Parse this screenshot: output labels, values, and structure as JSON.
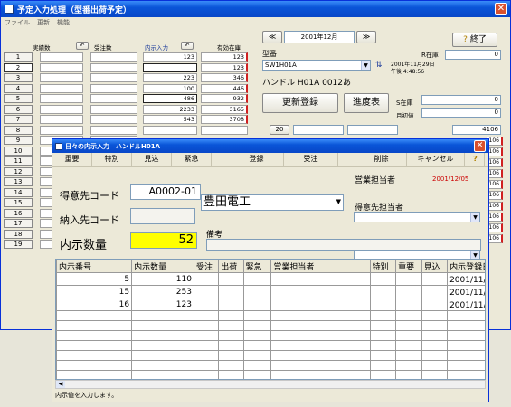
{
  "main": {
    "title": "予定入力処理（型番出荷予定）",
    "menu": [
      "ファイル",
      "更新",
      "機能"
    ],
    "headers": {
      "jisseki": "実績数",
      "juchu": "受注数",
      "naiji": "内示入力",
      "yuko": "有効在庫"
    },
    "rows": [
      {
        "n": "1",
        "naiji": "123",
        "yuko": "123"
      },
      {
        "n": "2",
        "naiji": "",
        "yuko": "123"
      },
      {
        "n": "3",
        "naiji": "223",
        "yuko": "346"
      },
      {
        "n": "4",
        "naiji": "100",
        "yuko": "446"
      },
      {
        "n": "5",
        "naiji": "486",
        "yuko": "932"
      },
      {
        "n": "6",
        "naiji": "2233",
        "yuko": "3165"
      },
      {
        "n": "7",
        "naiji": "543",
        "yuko": "3708"
      },
      {
        "n": "8",
        "naiji": "",
        "yuko": ""
      },
      {
        "n": "9",
        "naiji": "",
        "yuko": ""
      },
      {
        "n": "10",
        "naiji": "",
        "yuko": ""
      },
      {
        "n": "11",
        "naiji": "",
        "yuko": ""
      },
      {
        "n": "12",
        "naiji": "",
        "yuko": ""
      },
      {
        "n": "13",
        "naiji": "",
        "yuko": ""
      },
      {
        "n": "14",
        "naiji": "",
        "yuko": ""
      },
      {
        "n": "15",
        "naiji": "",
        "yuko": ""
      },
      {
        "n": "16",
        "naiji": "",
        "yuko": ""
      },
      {
        "n": "17",
        "naiji": "",
        "yuko": ""
      },
      {
        "n": "18",
        "naiji": "",
        "yuko": ""
      },
      {
        "n": "19",
        "naiji": "",
        "yuko": ""
      }
    ],
    "prev": "≪",
    "month": "2001年12月",
    "next": "≫",
    "end_label": "終了",
    "kataban_label": "型番",
    "r_zaiko_label": "R在庫",
    "r_zaiko_value": "0",
    "kataban_value": "SW1H01A",
    "date_line1": "2001年11月29日",
    "date_line2": "午後 4:48:56",
    "product_name": "ハンドル H01A 0012あ",
    "koshin_label": "更新登録",
    "shinchoku_label": "進度表",
    "s_zaiko_label": "S在庫",
    "s_zaiko_value": "0",
    "getsusho_label": "月初値",
    "getsusho_value": "0",
    "total_value": "4106",
    "row20": "20",
    "right_col_values": [
      "106",
      "106",
      "106",
      "106",
      "106",
      "106",
      "106",
      "106",
      "106",
      "106"
    ]
  },
  "sub": {
    "title": "日々の内示入力　ハンドルH01A",
    "toolbar": [
      "重要",
      "特別",
      "見込",
      "緊急",
      "登録",
      "受注",
      "削除",
      "キャンセル"
    ],
    "tokuisaki_label": "得意先コード",
    "tokuisaki_code": "A0002-01",
    "tokuisaki_name": "豊田電工",
    "eigyo_label": "営業担当者",
    "eigyo_date": "2001/12/05",
    "nonyusaki_label": "納入先コード",
    "tokuisaki_tanto_label": "得意先担当者",
    "naiji_label": "内示数量",
    "naiji_value": "52",
    "biko_label": "備考",
    "columns": [
      "内示番号",
      "内示数量",
      "受注",
      "出荷",
      "緊急",
      "営業担当者",
      "特別",
      "重要",
      "見込",
      "内示登録日"
    ],
    "rows": [
      {
        "no": "5",
        "qty": "110",
        "date": "2001/11/29 午後"
      },
      {
        "no": "15",
        "qty": "253",
        "date": "2001/11/29 午後"
      },
      {
        "no": "16",
        "qty": "123",
        "date": "2001/11/29 午後"
      }
    ],
    "status": "内示値を入力します。"
  },
  "colors": {
    "accent": "#0a55d8",
    "highlight": "#ffff00",
    "date_red": "#cc0000"
  }
}
